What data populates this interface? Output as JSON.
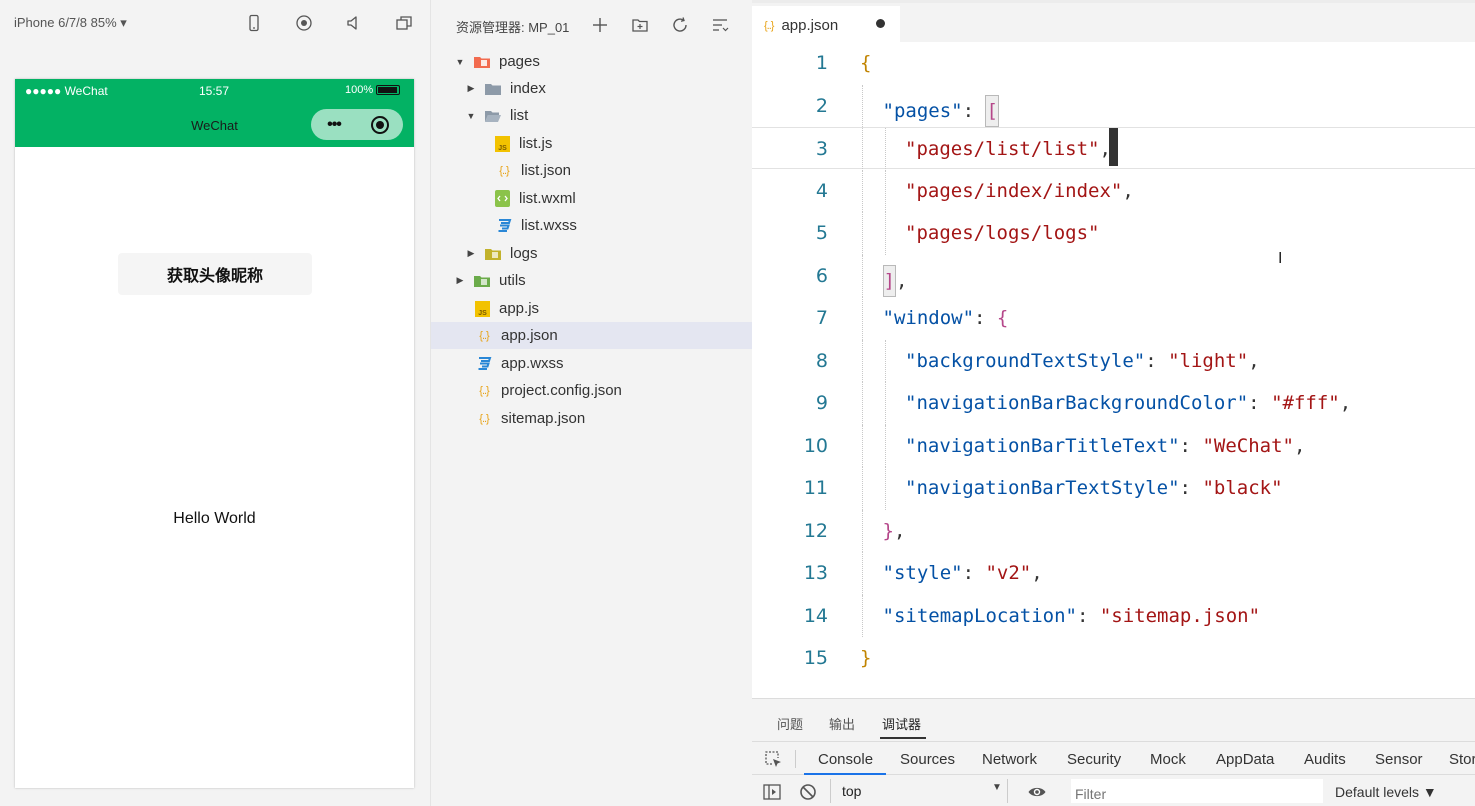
{
  "simulator": {
    "device_label": "iPhone 6/7/8 85% ▾",
    "status_signal": "●●●●● WeChat",
    "status_time": "15:57",
    "status_battery": "100%",
    "nav_title": "WeChat",
    "capsule_more": "•••",
    "profile_button": "获取头像昵称",
    "hello_text": "Hello World",
    "header_color": "#03b264"
  },
  "explorer": {
    "title": "资源管理器: MP_01",
    "tree": [
      {
        "label": "pages",
        "type": "folder-pages",
        "open": true
      },
      {
        "label": "index",
        "type": "folder",
        "open": false
      },
      {
        "label": "list",
        "type": "folder",
        "open": true
      },
      {
        "label": "list.js",
        "type": "js"
      },
      {
        "label": "list.json",
        "type": "json"
      },
      {
        "label": "list.wxml",
        "type": "wxml"
      },
      {
        "label": "list.wxss",
        "type": "wxss"
      },
      {
        "label": "logs",
        "type": "folder-logs",
        "open": false
      },
      {
        "label": "utils",
        "type": "folder-utils",
        "open": false
      },
      {
        "label": "app.js",
        "type": "js"
      },
      {
        "label": "app.json",
        "type": "json",
        "selected": true
      },
      {
        "label": "app.wxss",
        "type": "wxss"
      },
      {
        "label": "project.config.json",
        "type": "json"
      },
      {
        "label": "sitemap.json",
        "type": "json"
      }
    ]
  },
  "editor": {
    "tab_icon": "{..}",
    "tab_label": "app.json",
    "line_numbers": [
      "1",
      "2",
      "3",
      "4",
      "5",
      "6",
      "7",
      "8",
      "9",
      "10",
      "11",
      "12",
      "13",
      "14",
      "15"
    ],
    "lines": [
      [
        {
          "t": "{",
          "c": "b"
        }
      ],
      [
        {
          "t": "\"pages\"",
          "c": "k"
        },
        {
          "t": ": "
        },
        {
          "t": "[",
          "c": "b2",
          "hl": true
        }
      ],
      [
        {
          "t": "\"pages/list/list\"",
          "c": "s"
        },
        {
          "t": ","
        }
      ],
      [
        {
          "t": "\"pages/index/index\"",
          "c": "s"
        },
        {
          "t": ","
        }
      ],
      [
        {
          "t": "\"pages/logs/logs\"",
          "c": "s"
        }
      ],
      [
        {
          "t": "]",
          "c": "b2",
          "hl": true
        },
        {
          "t": ","
        }
      ],
      [
        {
          "t": "\"window\"",
          "c": "k"
        },
        {
          "t": ": "
        },
        {
          "t": "{",
          "c": "b2"
        }
      ],
      [
        {
          "t": "\"backgroundTextStyle\"",
          "c": "k"
        },
        {
          "t": ": "
        },
        {
          "t": "\"light\"",
          "c": "s"
        },
        {
          "t": ","
        }
      ],
      [
        {
          "t": "\"navigationBarBackgroundColor\"",
          "c": "k"
        },
        {
          "t": ": "
        },
        {
          "t": "\"#fff\"",
          "c": "s"
        },
        {
          "t": ","
        }
      ],
      [
        {
          "t": "\"navigationBarTitleText\"",
          "c": "k"
        },
        {
          "t": ": "
        },
        {
          "t": "\"WeChat\"",
          "c": "s"
        },
        {
          "t": ","
        }
      ],
      [
        {
          "t": "\"navigationBarTextStyle\"",
          "c": "k"
        },
        {
          "t": ": "
        },
        {
          "t": "\"black\"",
          "c": "s"
        }
      ],
      [
        {
          "t": "}",
          "c": "b2"
        },
        {
          "t": ","
        }
      ],
      [
        {
          "t": "\"style\"",
          "c": "k"
        },
        {
          "t": ": "
        },
        {
          "t": "\"v2\"",
          "c": "s"
        },
        {
          "t": ","
        }
      ],
      [
        {
          "t": "\"sitemapLocation\"",
          "c": "k"
        },
        {
          "t": ": "
        },
        {
          "t": "\"sitemap.json\"",
          "c": "s"
        }
      ],
      [
        {
          "t": "}",
          "c": "b"
        }
      ]
    ],
    "indent_levels": [
      0,
      1,
      2,
      2,
      2,
      1,
      1,
      2,
      2,
      2,
      2,
      1,
      1,
      1,
      0
    ]
  },
  "panel": {
    "tabs": [
      "问题",
      "输出",
      "调试器"
    ],
    "devtools_tabs": [
      "Console",
      "Sources",
      "Network",
      "Security",
      "Mock",
      "AppData",
      "Audits",
      "Sensor",
      "Stor"
    ],
    "context": "top",
    "filter_placeholder": "Filter",
    "levels": "Default levels ▼"
  }
}
